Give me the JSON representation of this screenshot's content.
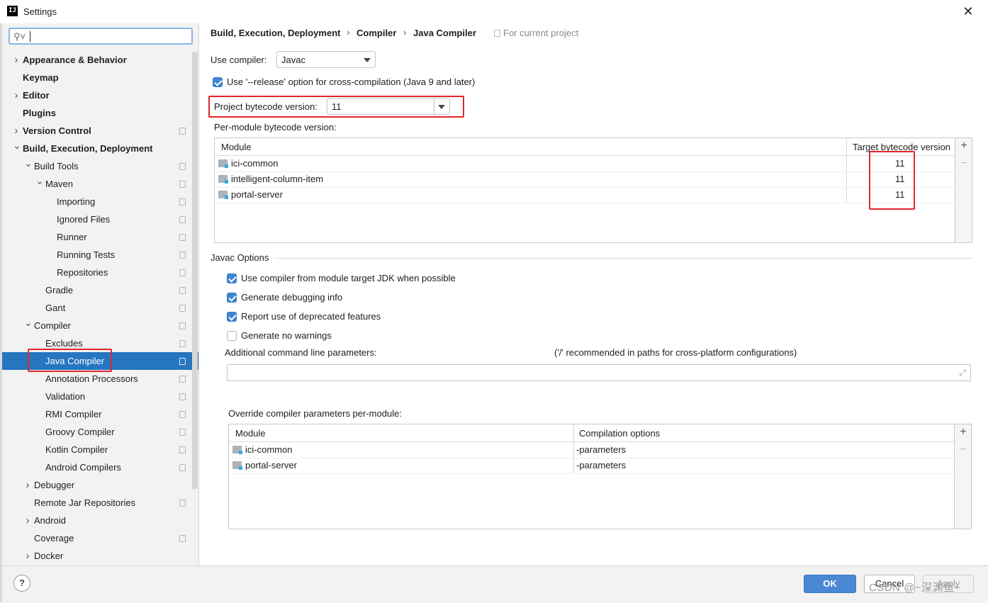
{
  "window": {
    "title": "Settings",
    "app_icon_text": "IJ",
    "close_symbol": "✕"
  },
  "search": {
    "value": ""
  },
  "sidebar": {
    "items": [
      {
        "label": "Appearance & Behavior",
        "bold": true,
        "arrow": "right",
        "level": 0,
        "proj": false,
        "selected": false
      },
      {
        "label": "Keymap",
        "bold": true,
        "arrow": "",
        "level": 0,
        "proj": false,
        "selected": false
      },
      {
        "label": "Editor",
        "bold": true,
        "arrow": "right",
        "level": 0,
        "proj": false,
        "selected": false
      },
      {
        "label": "Plugins",
        "bold": true,
        "arrow": "",
        "level": 0,
        "proj": false,
        "selected": false
      },
      {
        "label": "Version Control",
        "bold": true,
        "arrow": "right",
        "level": 0,
        "proj": true,
        "selected": false
      },
      {
        "label": "Build, Execution, Deployment",
        "bold": true,
        "arrow": "down",
        "level": 0,
        "proj": false,
        "selected": false
      },
      {
        "label": "Build Tools",
        "bold": false,
        "arrow": "down",
        "level": 1,
        "proj": true,
        "selected": false
      },
      {
        "label": "Maven",
        "bold": false,
        "arrow": "down",
        "level": 2,
        "proj": true,
        "selected": false
      },
      {
        "label": "Importing",
        "bold": false,
        "arrow": "",
        "level": 3,
        "proj": true,
        "selected": false
      },
      {
        "label": "Ignored Files",
        "bold": false,
        "arrow": "",
        "level": 3,
        "proj": true,
        "selected": false
      },
      {
        "label": "Runner",
        "bold": false,
        "arrow": "",
        "level": 3,
        "proj": true,
        "selected": false
      },
      {
        "label": "Running Tests",
        "bold": false,
        "arrow": "",
        "level": 3,
        "proj": true,
        "selected": false
      },
      {
        "label": "Repositories",
        "bold": false,
        "arrow": "",
        "level": 3,
        "proj": true,
        "selected": false
      },
      {
        "label": "Gradle",
        "bold": false,
        "arrow": "",
        "level": 2,
        "proj": true,
        "selected": false
      },
      {
        "label": "Gant",
        "bold": false,
        "arrow": "",
        "level": 2,
        "proj": true,
        "selected": false
      },
      {
        "label": "Compiler",
        "bold": false,
        "arrow": "down",
        "level": 1,
        "proj": true,
        "selected": false
      },
      {
        "label": "Excludes",
        "bold": false,
        "arrow": "",
        "level": 2,
        "proj": true,
        "selected": false
      },
      {
        "label": "Java Compiler",
        "bold": false,
        "arrow": "",
        "level": 2,
        "proj": true,
        "selected": true
      },
      {
        "label": "Annotation Processors",
        "bold": false,
        "arrow": "",
        "level": 2,
        "proj": true,
        "selected": false
      },
      {
        "label": "Validation",
        "bold": false,
        "arrow": "",
        "level": 2,
        "proj": true,
        "selected": false
      },
      {
        "label": "RMI Compiler",
        "bold": false,
        "arrow": "",
        "level": 2,
        "proj": true,
        "selected": false
      },
      {
        "label": "Groovy Compiler",
        "bold": false,
        "arrow": "",
        "level": 2,
        "proj": true,
        "selected": false
      },
      {
        "label": "Kotlin Compiler",
        "bold": false,
        "arrow": "",
        "level": 2,
        "proj": true,
        "selected": false
      },
      {
        "label": "Android Compilers",
        "bold": false,
        "arrow": "",
        "level": 2,
        "proj": true,
        "selected": false
      },
      {
        "label": "Debugger",
        "bold": false,
        "arrow": "right",
        "level": 1,
        "proj": false,
        "selected": false
      },
      {
        "label": "Remote Jar Repositories",
        "bold": false,
        "arrow": "",
        "level": 1,
        "proj": true,
        "selected": false
      },
      {
        "label": "Android",
        "bold": false,
        "arrow": "right",
        "level": 1,
        "proj": false,
        "selected": false
      },
      {
        "label": "Coverage",
        "bold": false,
        "arrow": "",
        "level": 1,
        "proj": true,
        "selected": false
      },
      {
        "label": "Docker",
        "bold": false,
        "arrow": "right",
        "level": 1,
        "proj": false,
        "selected": false
      }
    ]
  },
  "breadcrumb": {
    "parts": [
      "Build, Execution, Deployment",
      "Compiler",
      "Java Compiler"
    ],
    "separator": "›",
    "for_project": "For current project"
  },
  "compiler": {
    "use_compiler_label": "Use compiler:",
    "use_compiler_value": "Javac",
    "release_option_label": "Use '--release' option for cross-compilation (Java 9 and later)",
    "release_option_checked": true,
    "project_bytecode_label": "Project bytecode version:",
    "project_bytecode_value": "11",
    "per_module_label": "Per-module bytecode version:",
    "module_table": {
      "columns": [
        "Module",
        "Target bytecode version"
      ],
      "rows": [
        {
          "module": "ici-common",
          "version": "11"
        },
        {
          "module": "intelligent-column-item",
          "version": "11"
        },
        {
          "module": "portal-server",
          "version": "11"
        }
      ]
    }
  },
  "javac": {
    "section_title": "Javac Options",
    "options": [
      {
        "label": "Use compiler from module target JDK when possible",
        "checked": true
      },
      {
        "label": "Generate debugging info",
        "checked": true
      },
      {
        "label": "Report use of deprecated features",
        "checked": true
      },
      {
        "label": "Generate no warnings",
        "checked": false
      }
    ],
    "params_label": "Additional command line parameters:",
    "params_hint": "('/' recommended in paths for cross-platform configurations)",
    "params_value": "",
    "override_label": "Override compiler parameters per-module:",
    "override_table": {
      "columns": [
        "Module",
        "Compilation options"
      ],
      "rows": [
        {
          "module": "ici-common",
          "options": "-parameters"
        },
        {
          "module": "portal-server",
          "options": "-parameters"
        }
      ]
    }
  },
  "toolbar": {
    "add_symbol": "+",
    "remove_symbol": "−"
  },
  "footer": {
    "help_label": "?",
    "ok_label": "OK",
    "cancel_label": "Cancel",
    "apply_label": "Apply",
    "watermark": "CSDN @~深渊鱼~"
  },
  "colors": {
    "selection": "#2675bf",
    "accent": "#4a88d4",
    "annotation": "#e3262b"
  }
}
